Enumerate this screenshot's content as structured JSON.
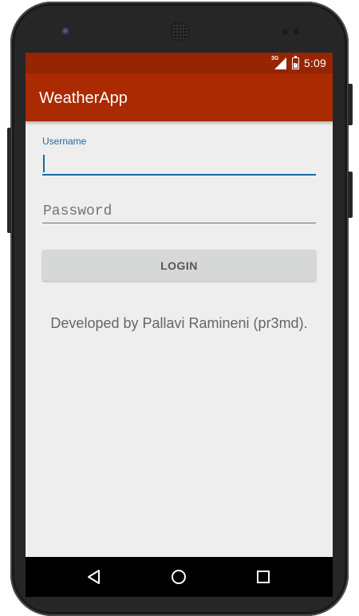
{
  "status_bar": {
    "network_type": "3G",
    "time": "5:09"
  },
  "app_bar": {
    "title": "WeatherApp"
  },
  "login_form": {
    "username_label": "Username",
    "username_value": "",
    "password_placeholder": "Password",
    "password_value": "",
    "login_button_label": "LOGIN"
  },
  "footer": {
    "credits": "Developed by Pallavi Ramineni (pr3md)."
  },
  "nav_bar": {
    "back": "back-icon",
    "home": "home-icon",
    "recents": "recents-icon"
  },
  "colors": {
    "status_bar": "#952503",
    "app_bar": "#aa2b01",
    "accent": "#1b6aa5",
    "background": "#eeeeee",
    "button": "#d6d7d7"
  }
}
